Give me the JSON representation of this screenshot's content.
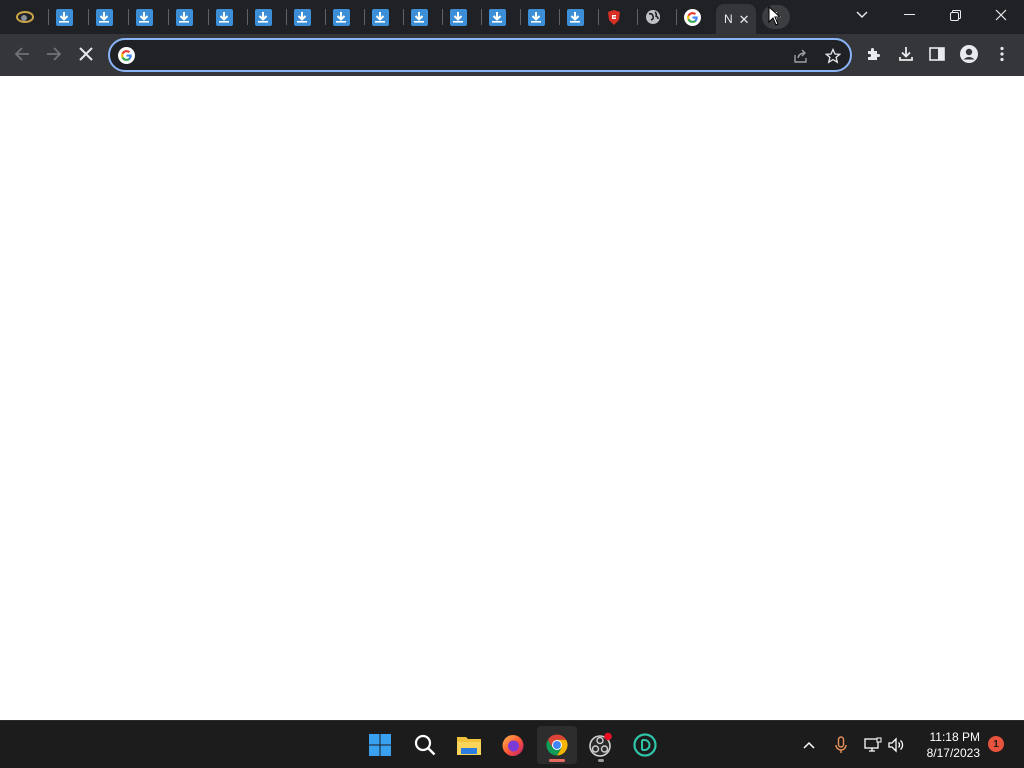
{
  "browser": {
    "active_tab": {
      "title_fragment": "N",
      "close_glyph": "✕"
    },
    "new_tab_glyph": "+",
    "tabs": [
      {
        "icon": "tool-favicon-icon"
      },
      {
        "icon": "download-favicon-icon"
      },
      {
        "icon": "download-favicon-icon"
      },
      {
        "icon": "download-favicon-icon"
      },
      {
        "icon": "download-favicon-icon"
      },
      {
        "icon": "download-favicon-icon"
      },
      {
        "icon": "download-favicon-icon"
      },
      {
        "icon": "download-favicon-icon"
      },
      {
        "icon": "download-favicon-icon"
      },
      {
        "icon": "download-favicon-icon"
      },
      {
        "icon": "download-favicon-icon"
      },
      {
        "icon": "download-favicon-icon"
      },
      {
        "icon": "download-favicon-icon"
      },
      {
        "icon": "download-favicon-icon"
      },
      {
        "icon": "shield-favicon-icon"
      },
      {
        "icon": "globe-favicon-icon"
      },
      {
        "icon": "google-favicon-icon"
      }
    ],
    "omnibox": {
      "value": "",
      "placeholder": ""
    },
    "colors": {
      "frame": "#202124",
      "toolbar": "#35363a",
      "focus_ring": "#8ab4f8",
      "download_icon": "#3c8fd6"
    }
  },
  "taskbar": {
    "apps": [
      "start-icon",
      "search-icon",
      "file-explorer-icon",
      "firefox-icon",
      "chrome-icon",
      "obs-icon",
      "edge-dev-icon"
    ],
    "clock": {
      "time": "11:18 PM",
      "date": "8/17/2023"
    },
    "notification_count": "1"
  }
}
